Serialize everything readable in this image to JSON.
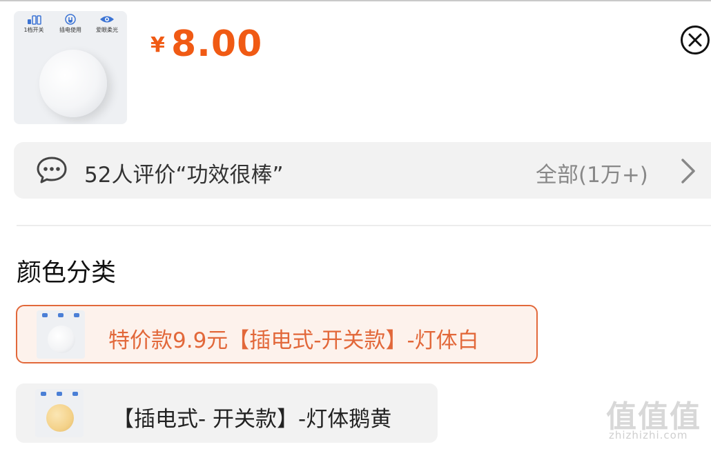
{
  "product": {
    "features": [
      {
        "label": "1档开关",
        "icon": "switch-icon"
      },
      {
        "label": "插电使用",
        "icon": "plug-icon"
      },
      {
        "label": "爱眼柔光",
        "icon": "eye-icon"
      }
    ],
    "price_symbol": "¥",
    "price": "8.00",
    "accent_color": "#f05a14"
  },
  "review": {
    "summary": "52人评价“功效很棒”",
    "all_label": "全部(1万+)"
  },
  "section": {
    "title": "颜色分类"
  },
  "options": [
    {
      "label": "特价款9.9元【插电式-开关款】-灯体白",
      "selected": true,
      "color": "white"
    },
    {
      "label": "【插电式- 开关款】-灯体鹅黄",
      "selected": false,
      "color": "yellow"
    }
  ],
  "watermark": {
    "logo": "值值值",
    "url": "zhizhizhi.com"
  }
}
